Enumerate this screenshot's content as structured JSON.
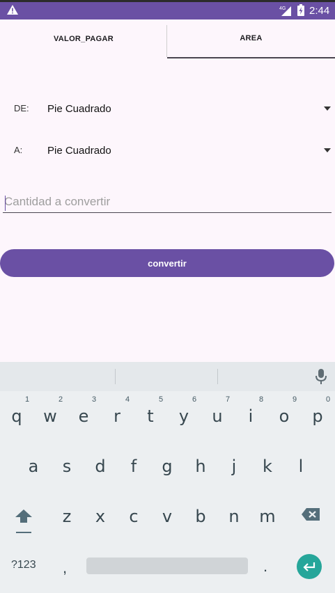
{
  "status_bar": {
    "time": "2:44",
    "network": "4G",
    "icons": [
      "warning-icon",
      "signal-icon",
      "battery-charging-icon"
    ]
  },
  "tabs": [
    {
      "label": "VALOR_PAGAR",
      "selected": false
    },
    {
      "label": "AREA",
      "selected": true
    }
  ],
  "form": {
    "from_label": "DE:",
    "from_value": "Pie Cuadrado",
    "to_label": "A:",
    "to_value": "Pie Cuadrado",
    "amount_placeholder": "Cantidad a convertir",
    "amount_value": "",
    "convert_label": "convertir"
  },
  "keyboard": {
    "row1": [
      {
        "key": "q",
        "hint": "1"
      },
      {
        "key": "w",
        "hint": "2"
      },
      {
        "key": "e",
        "hint": "3"
      },
      {
        "key": "r",
        "hint": "4"
      },
      {
        "key": "t",
        "hint": "5"
      },
      {
        "key": "y",
        "hint": "6"
      },
      {
        "key": "u",
        "hint": "7"
      },
      {
        "key": "i",
        "hint": "8"
      },
      {
        "key": "o",
        "hint": "9"
      },
      {
        "key": "p",
        "hint": "0"
      }
    ],
    "row2": [
      "a",
      "s",
      "d",
      "f",
      "g",
      "h",
      "j",
      "k",
      "l"
    ],
    "row3": [
      "z",
      "x",
      "c",
      "v",
      "b",
      "n",
      "m"
    ],
    "symbols_label": "?123",
    "comma": ",",
    "period": "."
  },
  "colors": {
    "primary": "#6a50a4",
    "background": "#fdf6fc",
    "keyboard_bg": "#eceff1",
    "enter_key": "#26a69a"
  }
}
